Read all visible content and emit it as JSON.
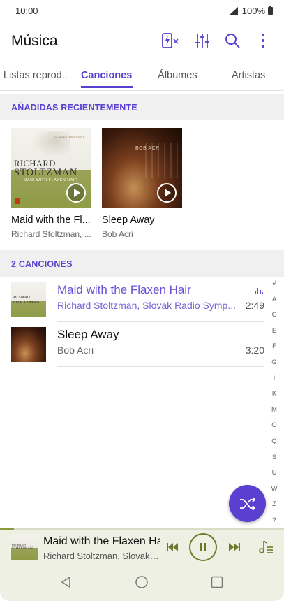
{
  "status_bar": {
    "time": "10:00",
    "battery": "100%"
  },
  "header": {
    "title": "Música",
    "icons": [
      "power-saving-icon",
      "equalizer-settings-icon",
      "search-icon",
      "more-options-icon"
    ]
  },
  "tabs": [
    {
      "label": "Listas reprod..",
      "active": false
    },
    {
      "label": "Canciones",
      "active": true
    },
    {
      "label": "Álbumes",
      "active": false
    },
    {
      "label": "Artistas",
      "active": false
    }
  ],
  "recent": {
    "heading": "AÑADIDAS RECIENTEMENTE",
    "albums": [
      {
        "title": "Maid with the Fl...",
        "artist": "Richard Stoltzman, ...",
        "cover_text": [
          "RICHARD",
          "STOLTZMAN",
          "MAID WITH FLAXEN HAIR",
          "CLAUDE DEBUSSY"
        ]
      },
      {
        "title": "Sleep Away",
        "artist": "Bob Acri",
        "cover_text": [
          "BOB ACRI"
        ]
      }
    ]
  },
  "songs": {
    "heading": "2 CANCIONES",
    "items": [
      {
        "title": "Maid with the Flaxen Hair",
        "subtitle": "Richard Stoltzman, Slovak Radio Symp...",
        "duration": "2:49",
        "playing": true
      },
      {
        "title": "Sleep Away",
        "subtitle": "Bob Acri",
        "duration": "3:20",
        "playing": false
      }
    ]
  },
  "alphabet_index": [
    "#",
    "A",
    "C",
    "E",
    "F",
    "G",
    "I",
    "K",
    "M",
    "O",
    "Q",
    "S",
    "U",
    "W",
    "Z",
    "?"
  ],
  "now_playing": {
    "title": "Maid with the Flaxen Hair",
    "subtitle": "Richard Stoltzman, Slovak Radio Symphony Orchestra",
    "progress": 0.05
  },
  "colors": {
    "accent": "#5b3fd1",
    "playing_text": "#6a4fd6",
    "player_bg": "#eef0e3",
    "player_controls": "#6b7a2a"
  }
}
